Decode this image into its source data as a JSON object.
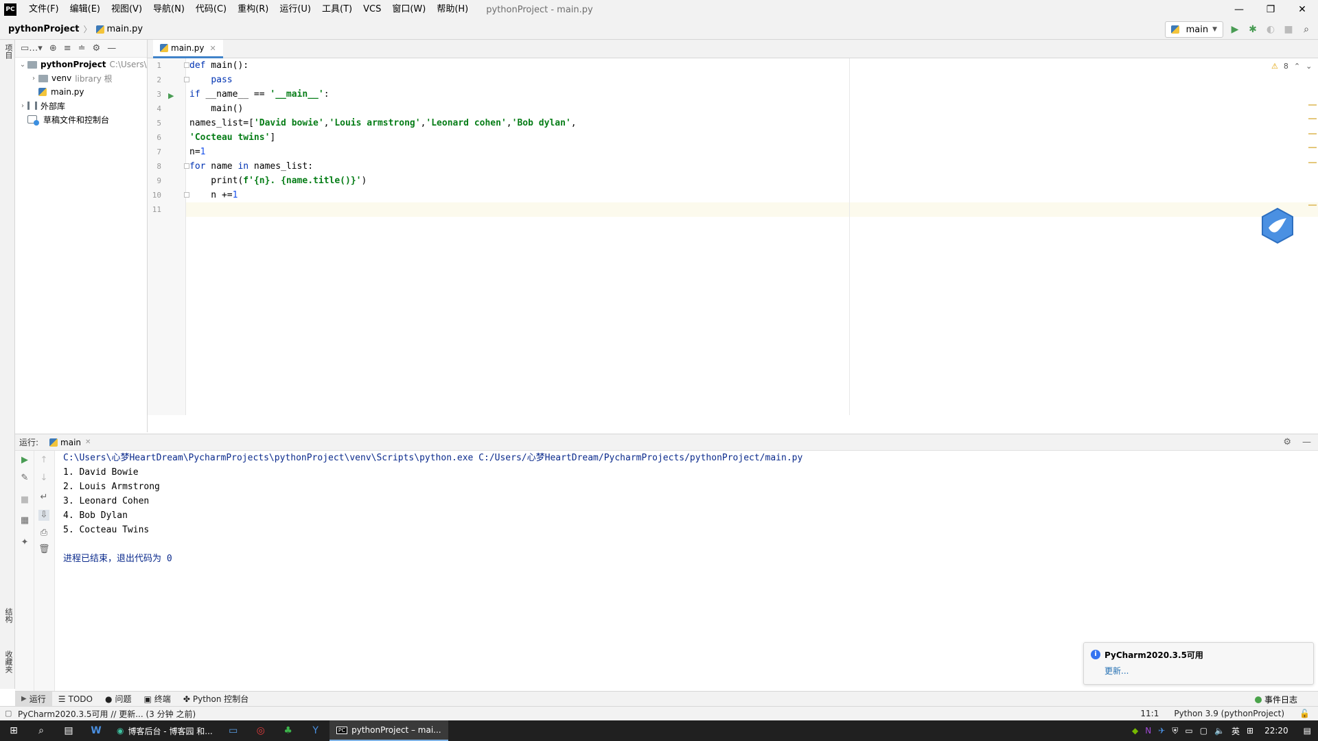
{
  "app": {
    "logo_text": "PC",
    "window_title": "pythonProject - main.py",
    "menu": [
      "文件(F)",
      "编辑(E)",
      "视图(V)",
      "导航(N)",
      "代码(C)",
      "重构(R)",
      "运行(U)",
      "工具(T)",
      "VCS",
      "窗口(W)",
      "帮助(H)"
    ],
    "win_controls": [
      "—",
      "❐",
      "✕"
    ]
  },
  "navbar": {
    "project": "pythonProject",
    "file": "main.py",
    "run_config": "main"
  },
  "left_stripe": {
    "project_tab": "项目",
    "structure_tab": "结构",
    "favorites_tab": "收藏夹"
  },
  "project_tree": {
    "rows": [
      {
        "name": "pythonProject",
        "extra": "C:\\Users\\"
      },
      {
        "name": "venv",
        "extra": "library 根"
      },
      {
        "name": "main.py",
        "extra": ""
      },
      {
        "name": "外部库",
        "extra": ""
      },
      {
        "name": "草稿文件和控制台",
        "extra": ""
      }
    ]
  },
  "editor": {
    "tab_label": "main.py",
    "warning_count": "8",
    "line_numbers": [
      "1",
      "2",
      "3",
      "4",
      "5",
      "6",
      "7",
      "8",
      "9",
      "10",
      "11"
    ],
    "code_lines": [
      "def main():",
      "    pass",
      "if __name__ == '__main__':",
      "    main()",
      "names_list=['David bowie','Louis armstrong','Leonard cohen','Bob dylan',",
      "'Cocteau twins']",
      "n=1",
      "for name in names_list:",
      "    print(f'{n}. {name.title()}')",
      "    n +=1",
      ""
    ]
  },
  "run_panel": {
    "label": "运行:",
    "tab": "main",
    "console_lines": [
      "C:\\Users\\心梦HeartDream\\PycharmProjects\\pythonProject\\venv\\Scripts\\python.exe C:/Users/心梦HeartDream/PycharmProjects/pythonProject/main.py",
      "1. David Bowie",
      "2. Louis Armstrong",
      "3. Leonard Cohen",
      "4. Bob Dylan",
      "5. Cocteau Twins",
      "",
      "进程已结束，退出代码为 0"
    ]
  },
  "notification": {
    "title": "PyCharm2020.3.5可用",
    "link": "更新..."
  },
  "toolwindow_bar": {
    "tabs": [
      "运行",
      "TODO",
      "问题",
      "终端",
      "Python 控制台"
    ],
    "event_log": "事件日志"
  },
  "statusbar": {
    "message": "PyCharm2020.3.5可用 // 更新... (3 分钟 之前)",
    "position": "11:1",
    "interpreter": "Python 3.9 (pythonProject)"
  },
  "taskbar": {
    "tasks": [
      "博客后台 - 博客园 和...",
      "pythonProject – mai..."
    ],
    "ime": "英",
    "time": "22:20"
  },
  "colors": {
    "keyword": "#0033b3",
    "string": "#067d17",
    "number": "#1750eb",
    "console_blue": "#0a2a8c",
    "accent": "#4083c9"
  }
}
